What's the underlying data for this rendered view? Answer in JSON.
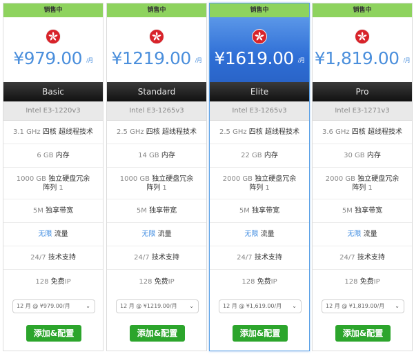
{
  "badge_label": "销售中",
  "month_suffix": "/月",
  "bandwidth_label": "独享带宽",
  "traffic_value": "无限",
  "traffic_label": "流量",
  "support_value": "24/7",
  "support_label": "技术支持",
  "ip_count": "128",
  "ip_label_1": "免费",
  "ip_label_2": "IP",
  "ram_label": "内存",
  "cpu_label": "四核 超线程技术",
  "disk_label_a": "独立硬盘冗余",
  "disk_label_b": "阵列",
  "disk_label_c": " 1",
  "add_button": "添加&配置",
  "colors": {
    "accent_blue": "#4b8fdc",
    "badge_green": "#8ed35e",
    "button_green": "#2ca52c"
  },
  "plans": [
    {
      "price": "¥979.00",
      "name": "Basic",
      "cpu": "Intel E3-1220v3",
      "ghz": "3.1 GHz",
      "ram": "6 GB",
      "disk": "1000 GB",
      "bandwidth": "5M",
      "select": "12 月 @ ¥979.00/月"
    },
    {
      "price": "¥1219.00",
      "name": "Standard",
      "cpu": "Intel E3-1265v3",
      "ghz": "2.5 GHz",
      "ram": "14 GB",
      "disk": "1000 GB",
      "bandwidth": "5M",
      "select": "12 月 @ ¥1219.00/月"
    },
    {
      "price": "¥1619.00",
      "name": "Elite",
      "cpu": "Intel E3-1265v3",
      "ghz": "2.5 GHz",
      "ram": "22 GB",
      "disk": "2000 GB",
      "bandwidth": "5M",
      "select": "12 月 @ ¥1,619.00/月"
    },
    {
      "price": "¥1,819.00",
      "name": "Pro",
      "cpu": "Intel E3-1271v3",
      "ghz": "3.6 GHz",
      "ram": "30 GB",
      "disk": "2000 GB",
      "bandwidth": "5M",
      "select": "12 月 @ ¥1,819.00/月"
    }
  ]
}
